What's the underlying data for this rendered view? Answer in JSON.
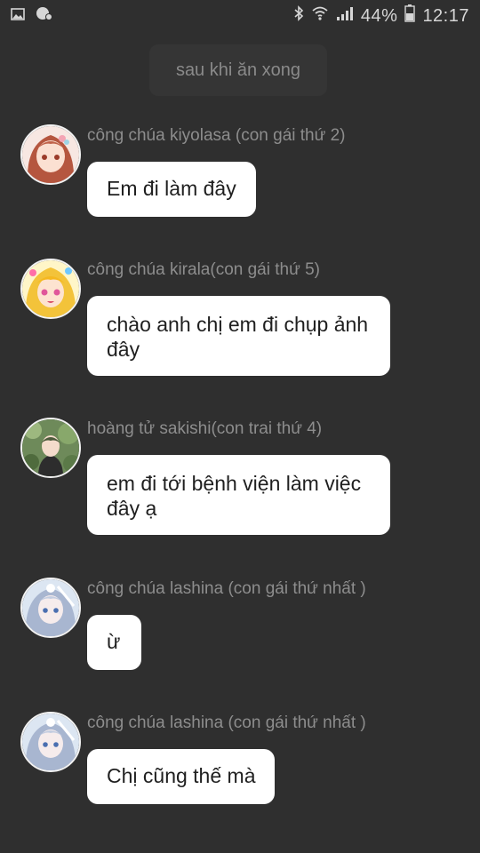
{
  "status_bar": {
    "battery": "44%",
    "time": "12:17",
    "icons": [
      "gallery-icon",
      "sync-icon",
      "bluetooth-icon",
      "wifi-icon",
      "signal-icon",
      "battery-icon"
    ]
  },
  "system_message": "sau khi ăn xong",
  "messages": [
    {
      "sender": "công chúa kiyolasa (con gái  thứ 2)",
      "text": "Em đi làm đây"
    },
    {
      "sender": "công chúa kirala(con gái thứ 5)",
      "text": "chào anh chị em đi chụp ảnh đây"
    },
    {
      "sender": "hoàng tử sakishi(con trai thứ 4)",
      "text": "em đi tới bệnh viện làm việc đây ạ"
    },
    {
      "sender": "công chúa lashina (con gái thứ nhất )",
      "text": "ừ"
    },
    {
      "sender": "công chúa lashina (con gái thứ nhất )",
      "text": "Chị cũng thế mà"
    }
  ]
}
